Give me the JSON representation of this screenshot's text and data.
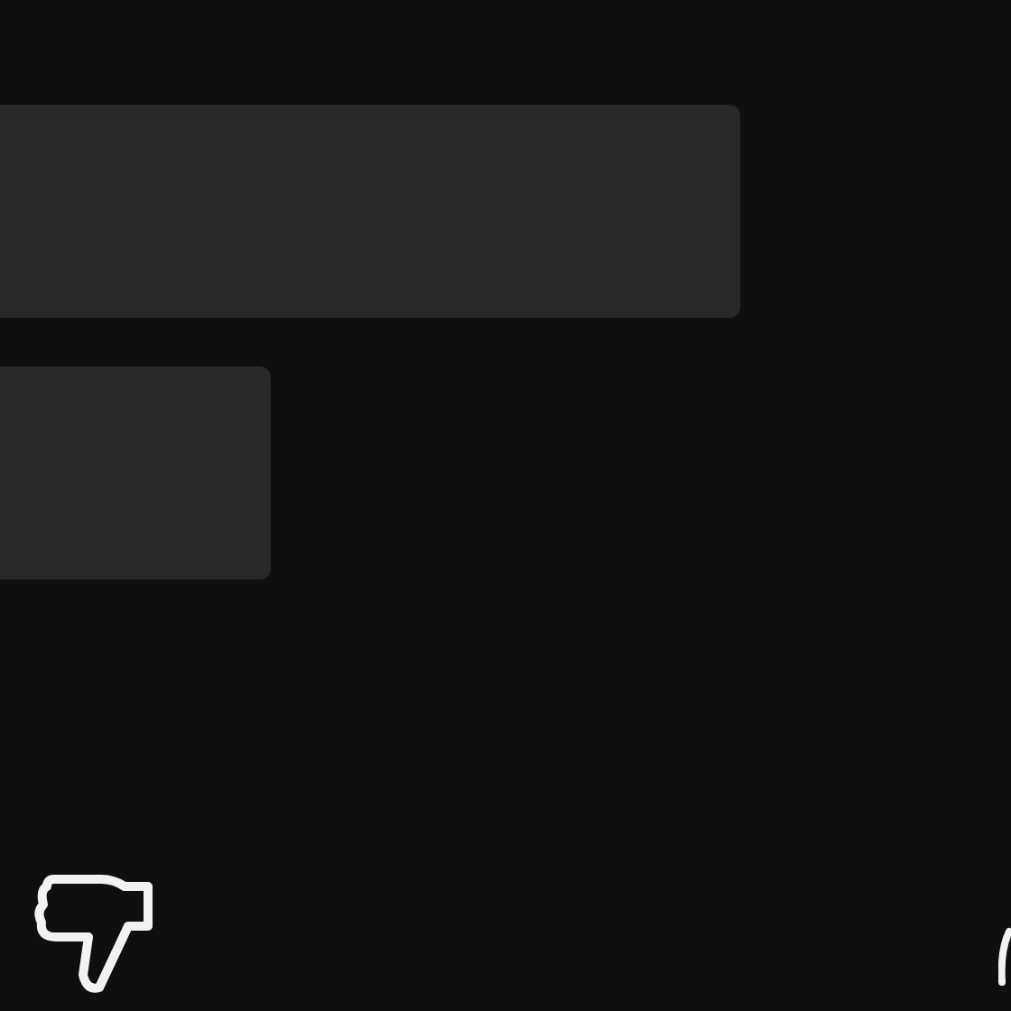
{
  "placeholders": [
    {
      "kind": "wide"
    },
    {
      "kind": "narrow"
    }
  ],
  "actions": [
    {
      "kind": "dislike"
    },
    {
      "kind": "cut-off"
    }
  ]
}
